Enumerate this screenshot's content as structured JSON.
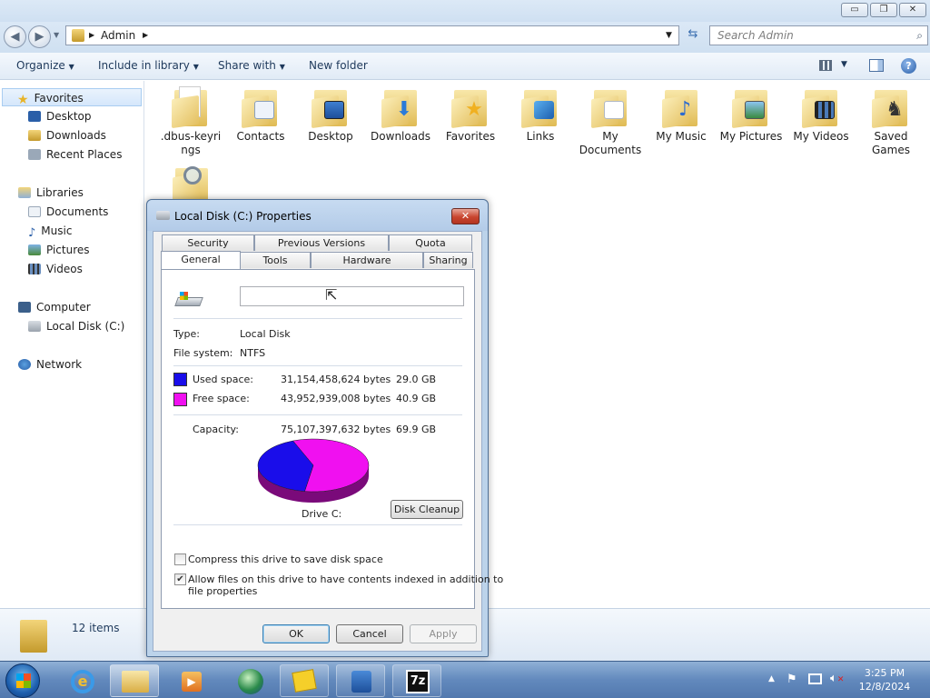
{
  "window": {
    "address_crumb": "Admin",
    "search_placeholder": "Search Admin",
    "caption_minimize": "▭",
    "caption_maximize": "❐",
    "caption_close": "✕"
  },
  "toolbar": {
    "organize": "Organize",
    "include_in_library": "Include in library",
    "share_with": "Share with",
    "new_folder": "New folder"
  },
  "nav": {
    "favorites": "Favorites",
    "desktop": "Desktop",
    "downloads": "Downloads",
    "recent_places": "Recent Places",
    "libraries": "Libraries",
    "documents": "Documents",
    "music": "Music",
    "pictures": "Pictures",
    "videos": "Videos",
    "computer": "Computer",
    "local_disk": "Local Disk (C:)",
    "network": "Network"
  },
  "items": [
    {
      "label": ".dbus-keyri ngs",
      "badge": "none"
    },
    {
      "label": "Contacts",
      "badge": "contact-card"
    },
    {
      "label": "Desktop",
      "badge": "monitor"
    },
    {
      "label": "Downloads",
      "badge": "down-arrow"
    },
    {
      "label": "Favorites",
      "badge": "star"
    },
    {
      "label": "Links",
      "badge": "link-arrow"
    },
    {
      "label": "My Documents",
      "badge": "document"
    },
    {
      "label": "My Music",
      "badge": "music-note"
    },
    {
      "label": "My Pictures",
      "badge": "picture"
    },
    {
      "label": "My Videos",
      "badge": "film"
    },
    {
      "label": "Saved Games",
      "badge": "chess-piece"
    }
  ],
  "details": {
    "count": "12 items"
  },
  "dialog": {
    "title": "Local Disk (C:) Properties",
    "tabs_top": [
      "Security",
      "Previous Versions",
      "Quota"
    ],
    "tabs_bottom": [
      "General",
      "Tools",
      "Hardware",
      "Sharing"
    ],
    "label_value": "",
    "type_label": "Type:",
    "type_value": "Local Disk",
    "fs_label": "File system:",
    "fs_value": "NTFS",
    "used_label": "Used space:",
    "used_bytes": "31,154,458,624 bytes",
    "used_gb": "29.0 GB",
    "free_label": "Free space:",
    "free_bytes": "43,952,939,008 bytes",
    "free_gb": "40.9 GB",
    "capacity_label": "Capacity:",
    "capacity_bytes": "75,107,397,632 bytes",
    "capacity_gb": "69.9 GB",
    "used_fraction": 0.415,
    "used_color": "#1a0dea",
    "free_color": "#f010f0",
    "drive_label": "Drive C:",
    "disk_cleanup": "Disk Cleanup",
    "compress_label": "Compress this drive to save disk space",
    "compress_checked": false,
    "index_label_1": "Allow files on this drive to have contents indexed in addition to",
    "index_label_2": "file properties",
    "index_checked": true,
    "ok": "OK",
    "cancel": "Cancel",
    "apply": "Apply"
  },
  "taskbar": {
    "time": "3:25 PM",
    "date": "12/8/2024"
  }
}
